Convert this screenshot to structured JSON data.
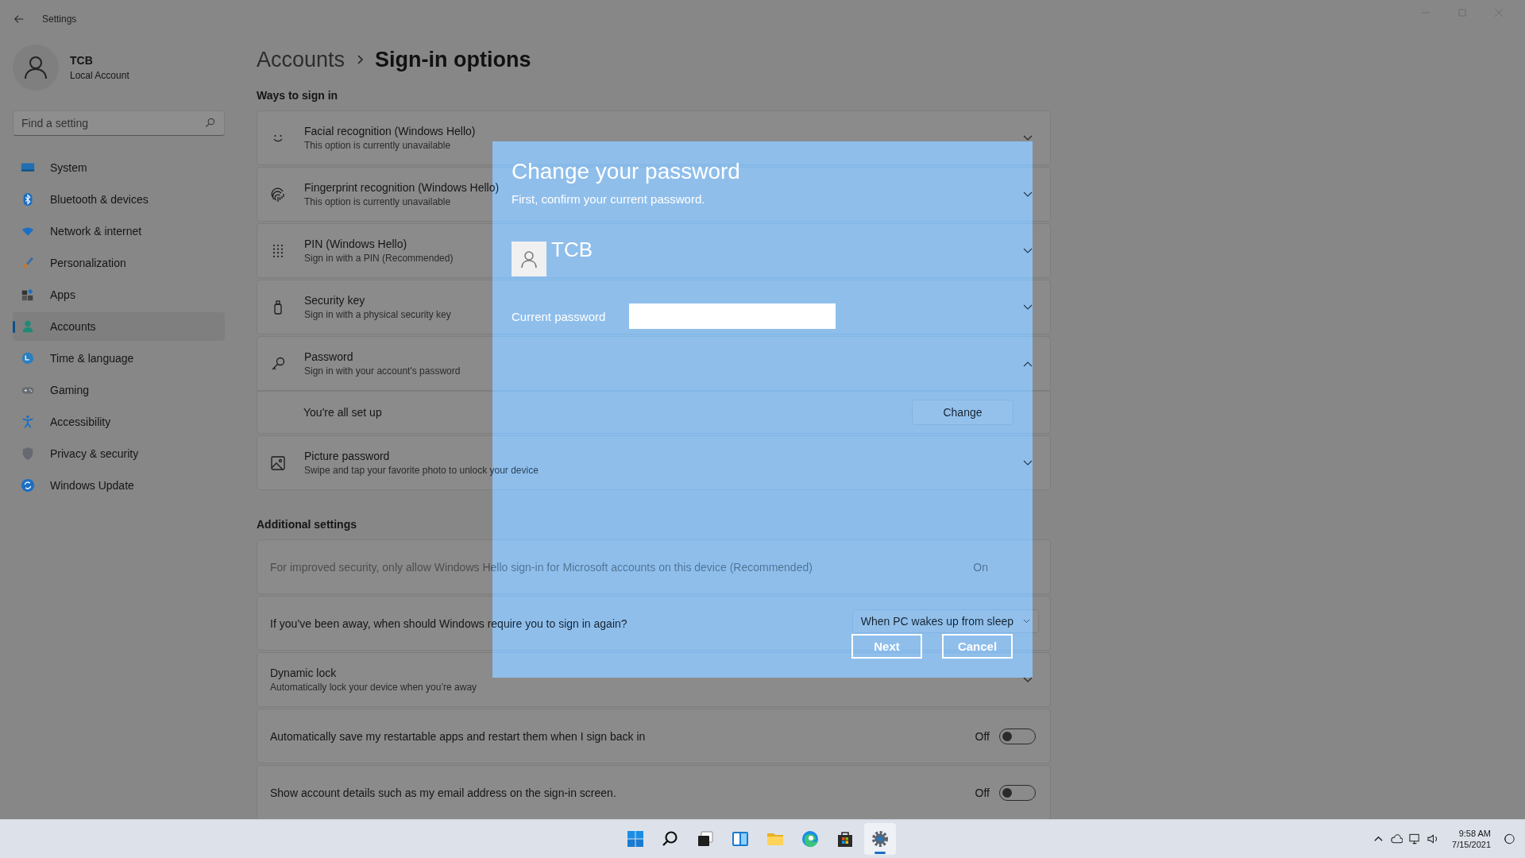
{
  "window": {
    "title": "Settings"
  },
  "account": {
    "name": "TCB",
    "type": "Local Account"
  },
  "search": {
    "placeholder": "Find a setting"
  },
  "nav": [
    {
      "label": "System",
      "selected": false
    },
    {
      "label": "Bluetooth & devices",
      "selected": false
    },
    {
      "label": "Network & internet",
      "selected": false
    },
    {
      "label": "Personalization",
      "selected": false
    },
    {
      "label": "Apps",
      "selected": false
    },
    {
      "label": "Accounts",
      "selected": true
    },
    {
      "label": "Time & language",
      "selected": false
    },
    {
      "label": "Gaming",
      "selected": false
    },
    {
      "label": "Accessibility",
      "selected": false
    },
    {
      "label": "Privacy & security",
      "selected": false
    },
    {
      "label": "Windows Update",
      "selected": false
    }
  ],
  "breadcrumb": {
    "parent": "Accounts",
    "current": "Sign-in options"
  },
  "ways": {
    "heading": "Ways to sign in",
    "items": [
      {
        "title": "Facial recognition (Windows Hello)",
        "subtitle": "This option is currently unavailable",
        "expanded": false
      },
      {
        "title": "Fingerprint recognition (Windows Hello)",
        "subtitle": "This option is currently unavailable",
        "expanded": false
      },
      {
        "title": "PIN (Windows Hello)",
        "subtitle": "Sign in with a PIN (Recommended)",
        "expanded": false
      },
      {
        "title": "Security key",
        "subtitle": "Sign in with a physical security key",
        "expanded": false
      },
      {
        "title": "Password",
        "subtitle": "Sign in with your account's password",
        "expanded": true,
        "detail": {
          "text": "You're all set up",
          "button": "Change"
        }
      },
      {
        "title": "Picture password",
        "subtitle": "Swipe and tap your favorite photo to unlock your device",
        "expanded": false
      }
    ]
  },
  "additional": {
    "heading": "Additional settings",
    "items": [
      {
        "kind": "status",
        "text": "For improved security, only allow Windows Hello sign-in for Microsoft accounts on this device (Recommended)",
        "status": "On",
        "disabled": true
      },
      {
        "kind": "dropdown",
        "text": "If you’ve been away, when should Windows require you to sign in again?",
        "value": "When PC wakes up from sleep"
      },
      {
        "kind": "expander",
        "title": "Dynamic lock",
        "subtitle": "Automatically lock your device when you’re away",
        "expanded": false
      },
      {
        "kind": "toggle",
        "text": "Automatically save my restartable apps and restart them when I sign back in",
        "status": "Off",
        "on": false
      },
      {
        "kind": "toggle",
        "text": "Show account details such as my email address on the sign-in screen.",
        "status": "Off",
        "on": false
      }
    ]
  },
  "dialog": {
    "title": "Change your password",
    "subtitle": "First, confirm your current password.",
    "user": "TCB",
    "field_label": "Current password",
    "buttons": [
      "Next",
      "Cancel"
    ]
  },
  "taskbar": {
    "apps": [
      {
        "selected": false
      },
      {
        "selected": false
      },
      {
        "selected": false
      },
      {
        "selected": false
      },
      {
        "selected": false
      },
      {
        "selected": false
      },
      {
        "selected": false
      },
      {
        "selected": true
      }
    ]
  },
  "clock": {
    "time": "9:58 AM",
    "date": "7/15/2021"
  }
}
